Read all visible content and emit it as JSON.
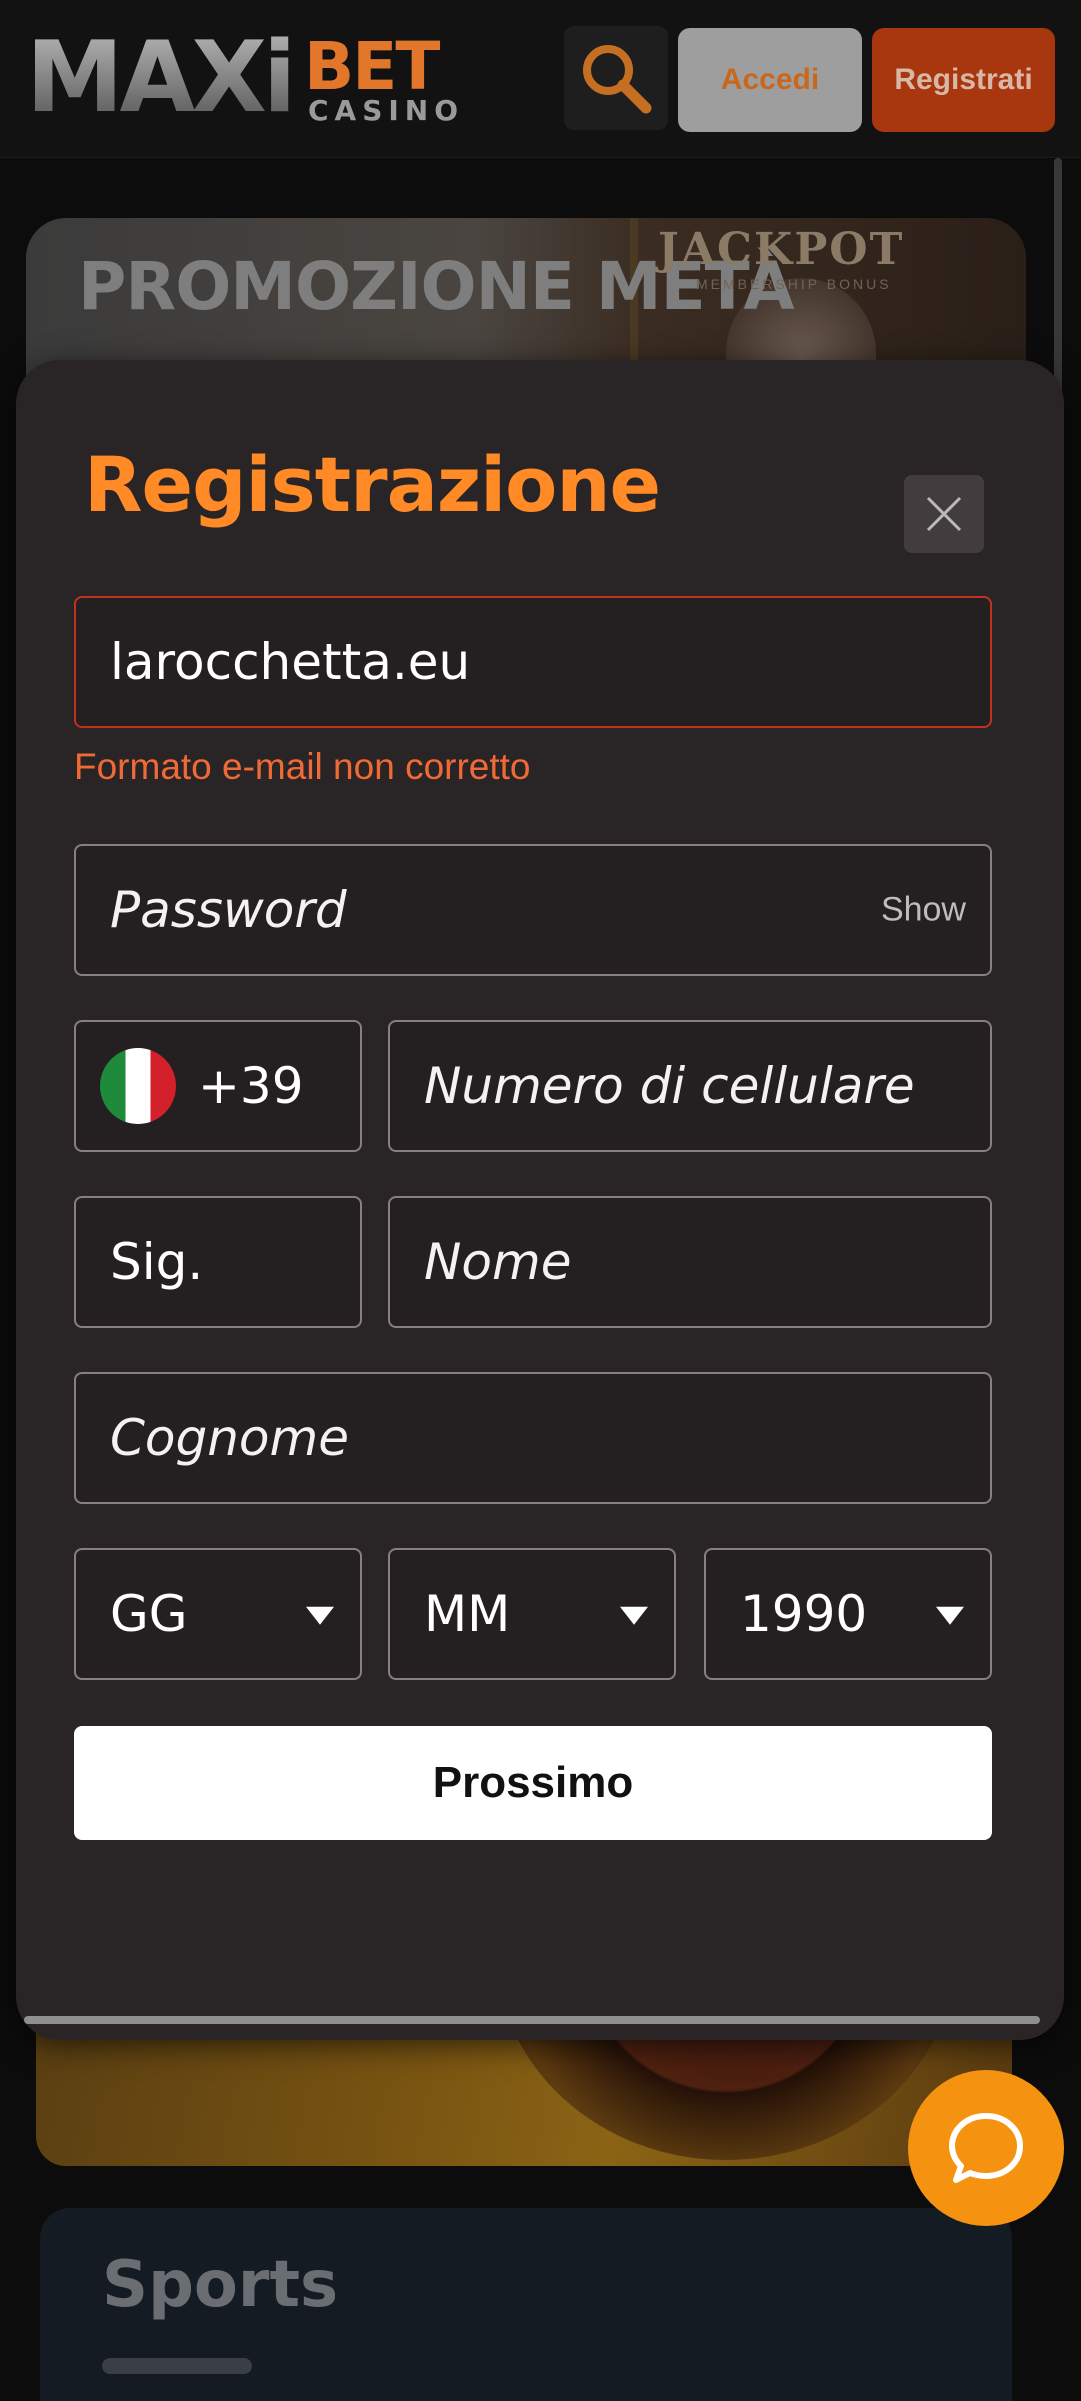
{
  "header": {
    "logo_maxi": "MAXi",
    "logo_bet": "BET",
    "logo_casino": "CASINO",
    "login_label": "Accedi",
    "register_label": "Registrati"
  },
  "background": {
    "promo_title": "PROMOZIONE METÀ",
    "jackpot_label": "JACKPOT",
    "jackpot_sub": "MEMBERSHIP BONUS",
    "sports_title": "Sports"
  },
  "modal": {
    "title": "Registrazione",
    "email": {
      "value": "larocchetta.eu",
      "error": "Formato e-mail non corretto"
    },
    "password": {
      "placeholder": "Password",
      "show_label": "Show"
    },
    "phone": {
      "prefix": "+39",
      "placeholder": "Numero di cellulare"
    },
    "salutation": {
      "value": "Sig."
    },
    "first_name": {
      "placeholder": "Nome"
    },
    "last_name": {
      "placeholder": "Cognome"
    },
    "birth_date": {
      "day": "GG",
      "month": "MM",
      "year": "1990"
    },
    "next_label": "Prossimo"
  },
  "colors": {
    "accent": "#ff8a26",
    "error": "#f06a35",
    "modal_bg": "#292426",
    "chat": "#f5920f"
  }
}
